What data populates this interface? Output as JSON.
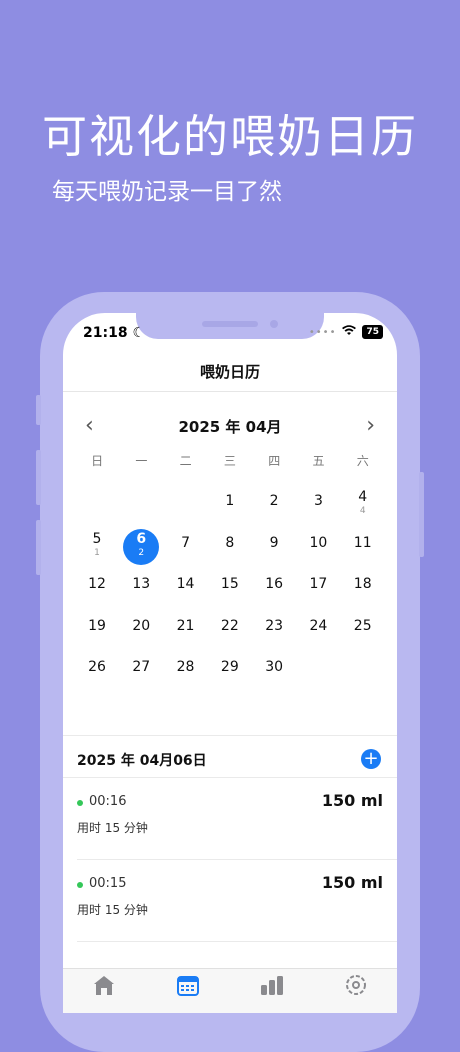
{
  "hero": {
    "title": "可视化的喂奶日历",
    "subtitle": "每天喂奶记录一目了然"
  },
  "status": {
    "time": "21:18",
    "battery": "75"
  },
  "nav": {
    "title": "喂奶日历"
  },
  "calendar": {
    "month_label": "2025 年 04月",
    "weekdays": [
      "日",
      "一",
      "二",
      "三",
      "四",
      "五",
      "六"
    ],
    "days": [
      {
        "n": "1",
        "c": ""
      },
      {
        "n": "2",
        "c": ""
      },
      {
        "n": "3",
        "c": ""
      },
      {
        "n": "4",
        "c": "4"
      },
      {
        "n": "5",
        "c": "1"
      },
      {
        "n": "6",
        "c": "2",
        "sel": true
      },
      {
        "n": "7",
        "c": ""
      },
      {
        "n": "8",
        "c": ""
      },
      {
        "n": "9",
        "c": ""
      },
      {
        "n": "10",
        "c": ""
      },
      {
        "n": "11",
        "c": ""
      },
      {
        "n": "12",
        "c": ""
      },
      {
        "n": "13",
        "c": ""
      },
      {
        "n": "14",
        "c": ""
      },
      {
        "n": "15",
        "c": ""
      },
      {
        "n": "16",
        "c": ""
      },
      {
        "n": "17",
        "c": ""
      },
      {
        "n": "18",
        "c": ""
      },
      {
        "n": "19",
        "c": ""
      },
      {
        "n": "20",
        "c": ""
      },
      {
        "n": "21",
        "c": ""
      },
      {
        "n": "22",
        "c": ""
      },
      {
        "n": "23",
        "c": ""
      },
      {
        "n": "24",
        "c": ""
      },
      {
        "n": "25",
        "c": ""
      },
      {
        "n": "26",
        "c": ""
      },
      {
        "n": "27",
        "c": ""
      },
      {
        "n": "28",
        "c": ""
      },
      {
        "n": "29",
        "c": ""
      },
      {
        "n": "30",
        "c": ""
      }
    ],
    "first_weekday": 2,
    "accent": "#1A7CF5"
  },
  "day": {
    "title": "2025 年 04月06日",
    "records": [
      {
        "time": "00:16",
        "amount": "150 ml",
        "duration": "用时 15 分钟"
      },
      {
        "time": "00:15",
        "amount": "150 ml",
        "duration": "用时 15 分钟"
      }
    ]
  },
  "tabs": [
    {
      "name": "home-icon"
    },
    {
      "name": "calendar-icon",
      "active": true
    },
    {
      "name": "chart-icon"
    },
    {
      "name": "settings-icon"
    }
  ]
}
